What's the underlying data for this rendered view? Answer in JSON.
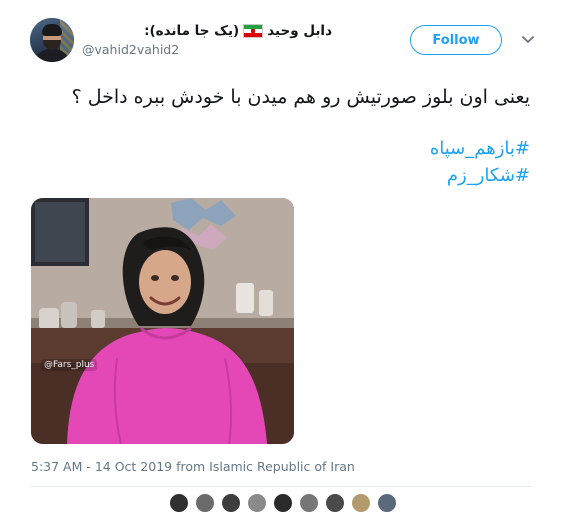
{
  "tweet": {
    "display_name": "دابل وحید",
    "name_suffix": "(یک جا مانده):",
    "handle": "@vahid2vahid2",
    "follow_label": "Follow",
    "text": "یعنی اون بلوز صورتیش رو هم میدن با خودش ببره داخل ؟",
    "hashtags": [
      "#بازهم_سپاه",
      "#شکار_زم"
    ],
    "image_watermark": "@Fars_plus",
    "timestamp": "5:37 AM - 14 Oct 2019 from Islamic Republic of Iran"
  },
  "colors": {
    "accent": "#1da1f2",
    "text": "#14171a",
    "muted": "#657786",
    "shirt": "#e448b6"
  },
  "icons": {
    "flag": "iran-flag-icon",
    "chevron": "chevron-down-icon"
  }
}
